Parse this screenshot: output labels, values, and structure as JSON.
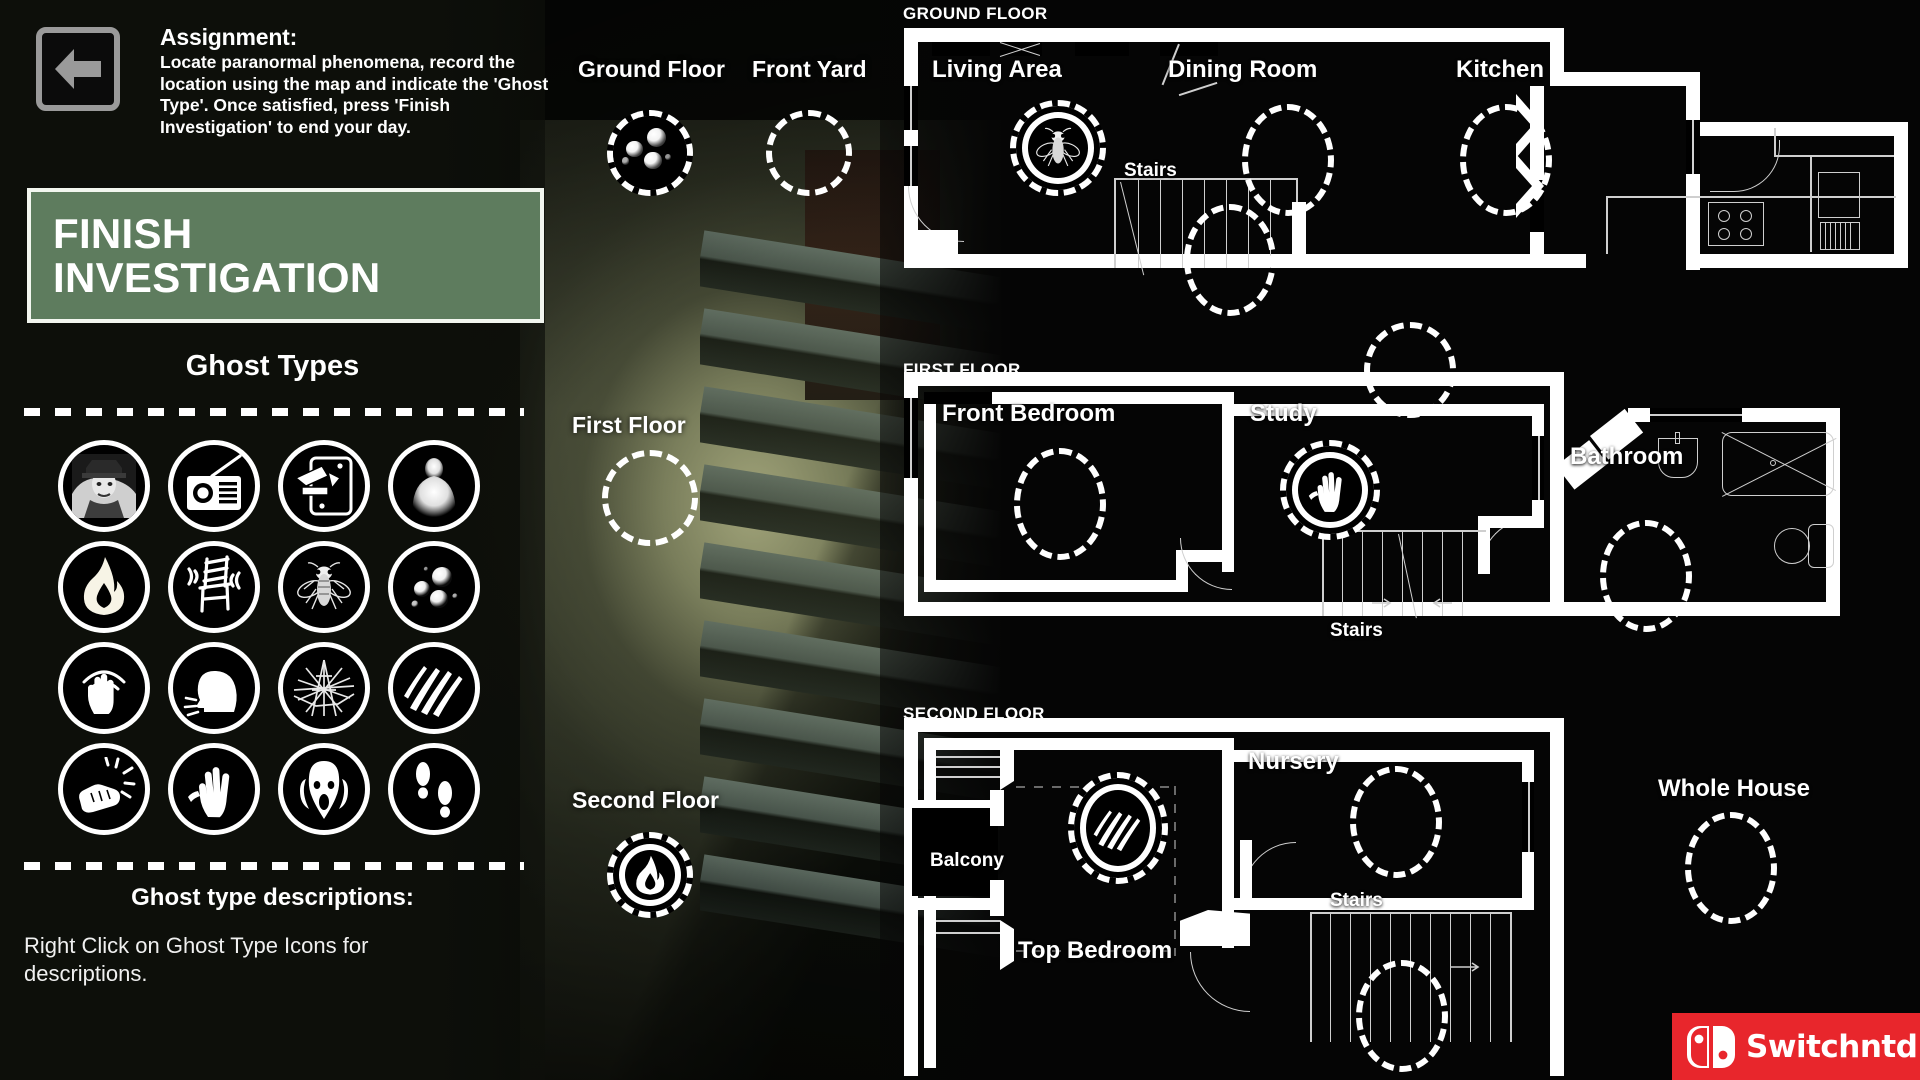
{
  "assignment": {
    "title": "Assignment:",
    "body": "Locate paranormal phenomena, record the location using the map and indicate the 'Ghost Type'. Once satisfied, press 'Finish Investigation' to end your day.",
    "back_icon": "arrow-left-icon"
  },
  "finish_button": {
    "line1": "FINISH",
    "line2": "INVESTIGATION",
    "color": "#5e7c5e",
    "border_color": "#f2f6ef"
  },
  "ghost_types": {
    "title": "Ghost Types",
    "descriptions_title": "Ghost type descriptions:",
    "descriptions_text": "Right Click on Ghost Type Icons for descriptions.",
    "icons": [
      {
        "name": "apparition-icon",
        "selected": false
      },
      {
        "name": "radio-icon",
        "selected": false
      },
      {
        "name": "phone-writing-icon",
        "selected": false
      },
      {
        "name": "figure-icon",
        "selected": false
      },
      {
        "name": "fire-icon",
        "selected": false
      },
      {
        "name": "shaking-chair-icon",
        "selected": false
      },
      {
        "name": "fly-icon",
        "selected": false
      },
      {
        "name": "orbs-icon",
        "selected": false
      },
      {
        "name": "touch-hand-icon",
        "selected": false
      },
      {
        "name": "whisper-head-icon",
        "selected": false
      },
      {
        "name": "broken-glass-icon",
        "selected": false
      },
      {
        "name": "scratches-icon",
        "selected": false
      },
      {
        "name": "knock-fist-icon",
        "selected": false
      },
      {
        "name": "handprint-icon",
        "selected": false
      },
      {
        "name": "scream-icon",
        "selected": false
      },
      {
        "name": "footprints-icon",
        "selected": false
      }
    ]
  },
  "location_markers": [
    {
      "label": "Ground Floor",
      "icon": "orbs-icon",
      "selected": true
    },
    {
      "label": "Front Yard",
      "icon": null,
      "selected": false
    },
    {
      "label": "First Floor",
      "icon": null,
      "selected": false
    },
    {
      "label": "Second Floor",
      "icon": "fire-icon",
      "selected": true
    }
  ],
  "floors": [
    {
      "caption": "GROUND FLOOR",
      "rooms": [
        {
          "label": "Living Area",
          "marker_icon": "fly-icon",
          "selected": true
        },
        {
          "label": "Dining Room",
          "marker_icon": null,
          "selected": false
        },
        {
          "label": "Kitchen",
          "marker_icon": null,
          "selected": false
        },
        {
          "label": "Stairs",
          "marker_icon": null,
          "selected": false
        }
      ]
    },
    {
      "caption": "FIRST FLOOR",
      "rooms": [
        {
          "label": "Front Bedroom",
          "marker_icon": null,
          "selected": false
        },
        {
          "label": "Study",
          "marker_icon": "handprint-icon",
          "selected": true
        },
        {
          "label": "Bathroom",
          "marker_icon": null,
          "selected": false
        },
        {
          "label": "Stairs",
          "marker_icon": null,
          "selected": false
        }
      ]
    },
    {
      "caption": "SECOND FLOOR",
      "rooms": [
        {
          "label": "Balcony",
          "marker_icon": null,
          "selected": false
        },
        {
          "label": "Top Bedroom",
          "marker_icon": "scratches-icon",
          "selected": true
        },
        {
          "label": "Nursery",
          "marker_icon": null,
          "selected": false
        },
        {
          "label": "Stairs",
          "marker_icon": null,
          "selected": false
        }
      ]
    }
  ],
  "whole_house": {
    "label": "Whole House",
    "selected": false
  },
  "watermark": {
    "text": "Switchntd.com",
    "color": "#e8262c"
  }
}
